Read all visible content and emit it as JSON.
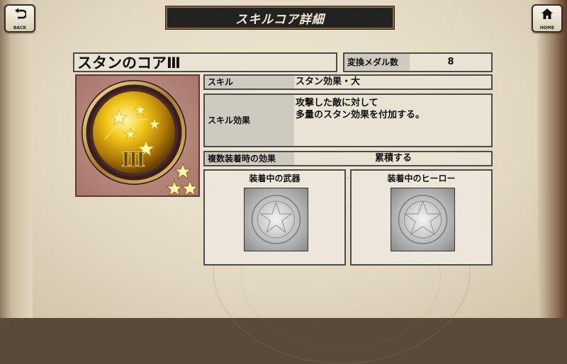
{
  "header": {
    "title": "スキルコア詳細",
    "back_label": "BACK",
    "home_label": "HOME"
  },
  "core": {
    "name": "スタンのコアⅢ",
    "numeral": "Ⅲ",
    "star_count": 3
  },
  "medal": {
    "label": "変換メダル数",
    "value": "8"
  },
  "skill": {
    "label": "スキル",
    "value": "スタン効果・大"
  },
  "effect": {
    "label": "スキル効果",
    "line1": "攻撃した敵に対して",
    "line2": "多量のスタン効果を付加する。"
  },
  "stacking": {
    "label": "複数装着時の効果",
    "value": "累積する"
  },
  "equipped": {
    "weapon_title": "装着中の武器",
    "hero_title": "装着中のヒーロー"
  }
}
